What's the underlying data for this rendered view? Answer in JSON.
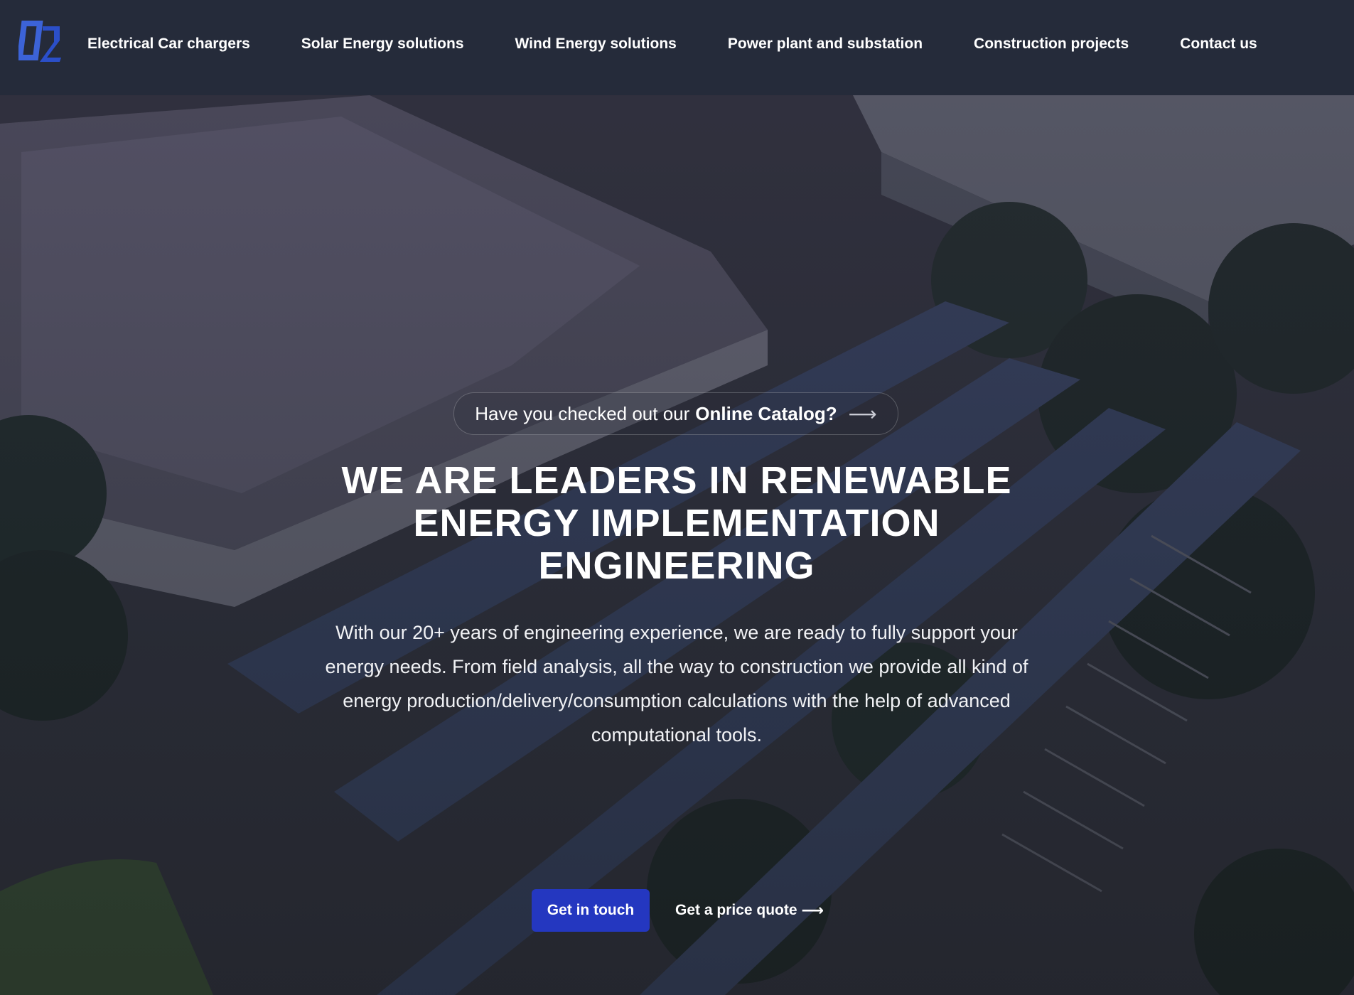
{
  "nav": {
    "logo_icon": "d2-logo-icon",
    "links": [
      {
        "label": "Electrical Car chargers"
      },
      {
        "label": "Solar Energy solutions"
      },
      {
        "label": "Wind Energy solutions"
      },
      {
        "label": "Power plant and substation"
      },
      {
        "label": "Construction projects"
      },
      {
        "label": "Contact us"
      }
    ]
  },
  "hero": {
    "catalog_prefix": "Have you checked out our",
    "catalog_link": "Online Catalog?",
    "catalog_arrow": "⟶",
    "headline_line1": "WE ARE LEADERS IN RENEWABLE",
    "headline_line2": "ENERGY IMPLEMENTATION",
    "headline_line3": "ENGINEERING",
    "description": "With our 20+ years of engineering experience, we are ready to fully support your energy needs. From field analysis, all the way to construction we provide all kind of energy production/delivery/consumption calculations with the help of advanced computational tools.",
    "primary_button": "Get in touch",
    "secondary_link": "Get a price quote",
    "secondary_arrow": "⟶",
    "background_icon": "aerial-solar-carport-image"
  },
  "colors": {
    "nav_bg": "#252b3a",
    "primary_button": "#2437c0",
    "logo_blue": "#3c63d8"
  }
}
